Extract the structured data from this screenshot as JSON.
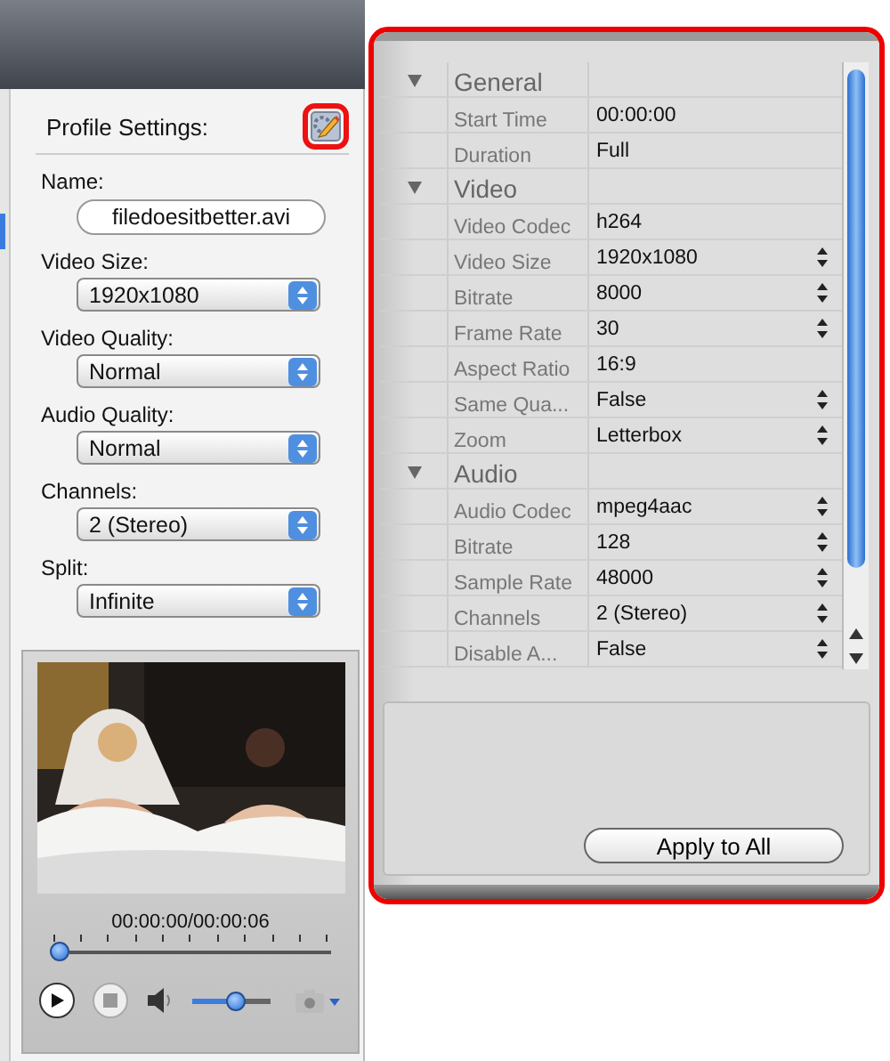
{
  "profile": {
    "heading": "Profile Settings:",
    "name_label": "Name:",
    "name_value": "filedoesitbetter.avi",
    "fields": [
      {
        "label": "Video Size:",
        "value": "1920x1080"
      },
      {
        "label": "Video Quality:",
        "value": "Normal"
      },
      {
        "label": "Audio Quality:",
        "value": "Normal"
      },
      {
        "label": "Channels:",
        "value": "2 (Stereo)"
      },
      {
        "label": "Split:",
        "value": "Infinite"
      }
    ]
  },
  "preview": {
    "time": "00:00:00/00:00:06",
    "position": {
      "level": 0
    },
    "volume": {
      "level": 0.55
    }
  },
  "properties": {
    "sections": [
      {
        "title": "General",
        "expanded": true,
        "rows": [
          {
            "name": "Start Time",
            "value": "00:00:00",
            "stepper": false
          },
          {
            "name": "Duration",
            "value": "Full",
            "stepper": false
          }
        ]
      },
      {
        "title": "Video",
        "expanded": true,
        "rows": [
          {
            "name": "Video Codec",
            "value": "h264",
            "stepper": false
          },
          {
            "name": "Video Size",
            "value": "1920x1080",
            "stepper": true
          },
          {
            "name": "Bitrate",
            "value": "8000",
            "stepper": true
          },
          {
            "name": "Frame Rate",
            "value": "30",
            "stepper": true
          },
          {
            "name": "Aspect Ratio",
            "value": "16:9",
            "stepper": false
          },
          {
            "name": "Same Qua...",
            "value": "False",
            "stepper": true
          },
          {
            "name": "Zoom",
            "value": "Letterbox",
            "stepper": true
          }
        ]
      },
      {
        "title": "Audio",
        "expanded": true,
        "rows": [
          {
            "name": "Audio Codec",
            "value": "mpeg4aac",
            "stepper": true
          },
          {
            "name": "Bitrate",
            "value": "128",
            "stepper": true
          },
          {
            "name": "Sample Rate",
            "value": "48000",
            "stepper": true
          },
          {
            "name": "Channels",
            "value": "2 (Stereo)",
            "stepper": true
          },
          {
            "name": "Disable A...",
            "value": "False",
            "stepper": true
          }
        ]
      }
    ]
  },
  "apply_button": "Apply to All"
}
